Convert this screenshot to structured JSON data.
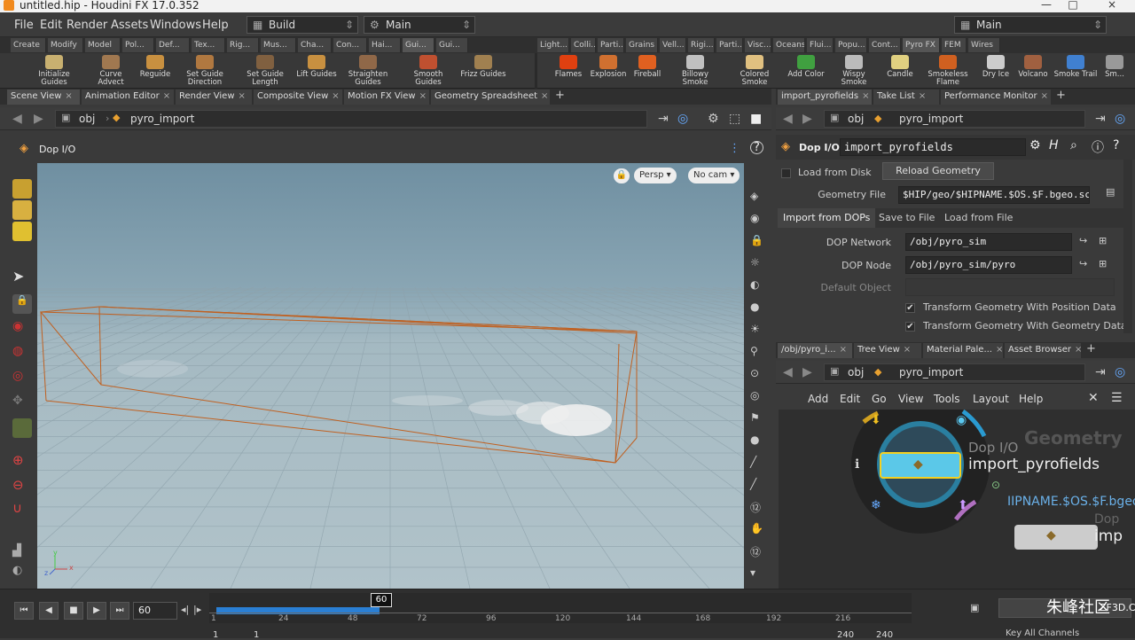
{
  "window": {
    "title": "untitled.hip - Houdini FX 17.0.352",
    "minimize": "—",
    "maximize": "□",
    "close": "×"
  },
  "menu": {
    "items": [
      "File",
      "Edit",
      "Render",
      "Assets",
      "Windows",
      "Help"
    ],
    "desktop": "Build",
    "main_left": "Main",
    "main_right": "Main"
  },
  "shelf_tabs_left": [
    "Create",
    "Modify",
    "Model",
    "Pol...",
    "Def...",
    "Tex...",
    "Rig...",
    "Mus...",
    "Cha...",
    "Con...",
    "Hai...",
    "Gui...",
    "Gui..."
  ],
  "shelf_tabs_right": [
    "Light...",
    "Colli...",
    "Parti...",
    "Grains",
    "Vell...",
    "Rigi...",
    "Parti...",
    "Visc...",
    "Oceans",
    "Flui...",
    "Popu...",
    "Cont...",
    "Pyro FX",
    "FEM",
    "Wires"
  ],
  "tools_left": [
    "Initialize Guides",
    "Curve Advect",
    "Reguide",
    "Set Guide Direction",
    "Set Guide Length",
    "Lift Guides",
    "Straighten Guides",
    "Smooth Guides",
    "Frizz Guides"
  ],
  "tools_right": [
    "Flames",
    "Explosion",
    "Fireball",
    "Billowy Smoke",
    "Colored Smoke",
    "Add Color",
    "Wispy Smoke",
    "Candle",
    "Smokeless Flame",
    "Dry Ice",
    "Volcano",
    "Smoke Trail",
    "Sm..."
  ],
  "left_panel_tabs": [
    "Scene View",
    "Animation Editor",
    "Render View",
    "Composite View",
    "Motion FX View",
    "Geometry Spreadsheet"
  ],
  "right_panel_tabs": [
    "import_pyrofields",
    "Take List",
    "Performance Monitor"
  ],
  "net_panel_tabs": [
    "/obj/pyro_i...",
    "Tree View",
    "Material Pale...",
    "Asset Browser"
  ],
  "path": {
    "root": "obj",
    "node": "pyro_import"
  },
  "viewport": {
    "title": "Dop I/O",
    "persp": "Persp ▾",
    "cam": "No cam ▾",
    "axis_x": "x",
    "axis_y": "y",
    "axis_z": "z"
  },
  "params": {
    "node_type": "Dop I/O",
    "node_name": "import_pyrofields",
    "load_from_disk": "Load from Disk",
    "reload_geometry": "Reload Geometry",
    "geometry_file_label": "Geometry File",
    "geometry_file": "$HIP/geo/$HIPNAME.$OS.$F.bgeo.sc",
    "tabs": [
      "Import from DOPs",
      "Save to File",
      "Load from File"
    ],
    "dop_network_label": "DOP Network",
    "dop_network": "/obj/pyro_sim",
    "dop_node_label": "DOP Node",
    "dop_node": "/obj/pyro_sim/pyro",
    "default_object_label": "Default Object",
    "transform_pos": "Transform Geometry With Position Data",
    "transform_geo": "Transform Geometry With Geometry Data"
  },
  "net_menu": [
    "Add",
    "Edit",
    "Go",
    "View",
    "Tools",
    "Layout",
    "Help"
  ],
  "network": {
    "context": "Geometry",
    "node_type": "Dop I/O",
    "node_name": "import_pyrofields",
    "node_file": "IIPNAME.$OS.$F.bgeo.s",
    "node2_type": "Dop",
    "node2_name": "imp"
  },
  "timeline": {
    "frame": "60",
    "current_marker": "60",
    "ticks": [
      "1",
      "24",
      "48",
      "72",
      "96",
      "120",
      "144",
      "168",
      "192",
      "216"
    ],
    "start": "1",
    "start2": "1",
    "end": "240",
    "end2": "240",
    "keys_all": "Key All Channels",
    "watermark": "朱峰社区",
    "watermark_url": "ZF3D.COM"
  },
  "colors": {
    "accent": "#f5a623",
    "progress": "#2a7fd4",
    "node_color": "#5bc8e8"
  }
}
